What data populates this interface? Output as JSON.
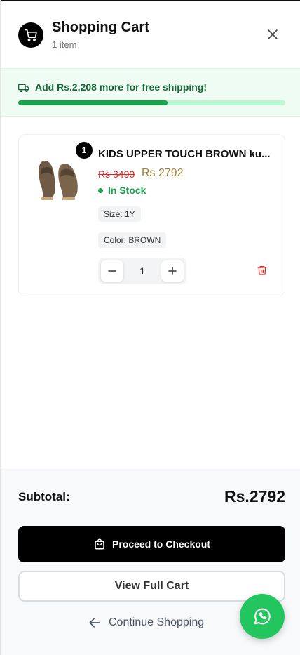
{
  "header": {
    "title": "Shopping Cart",
    "item_count": "1 item"
  },
  "shipping": {
    "message": "Add Rs.2,208 more for free shipping!",
    "progress_percent": 56,
    "accent": "#16a34a"
  },
  "cart": {
    "items": [
      {
        "quantity_badge": "1",
        "name": "KIDS UPPER TOUCH BROWN ku...",
        "original_price": "Rs 3490",
        "sale_price": "Rs 2792",
        "stock_status": "In Stock",
        "size": "Size: 1Y",
        "color": "Color: BROWN",
        "quantity": "1"
      }
    ]
  },
  "footer": {
    "subtotal_label": "Subtotal:",
    "subtotal_value": "Rs.2792",
    "checkout_label": "Proceed to Checkout",
    "view_cart_label": "View Full Cart",
    "continue_label": "Continue Shopping"
  },
  "icons": {
    "header": "shopping-cart-icon",
    "close": "close-icon",
    "shipping": "truck-icon",
    "remove": "trash-icon",
    "checkout": "shopping-bag-icon",
    "back": "arrow-left-icon",
    "chat": "whatsapp-icon"
  }
}
